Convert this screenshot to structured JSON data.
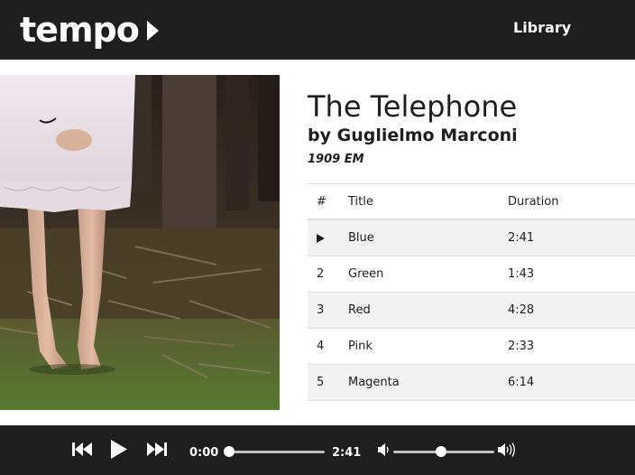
{
  "header": {
    "logo": "tempo",
    "nav_library": "Library"
  },
  "album": {
    "title": "The Telephone",
    "artist": "by Guglielmo Marconi",
    "year": "1909 EM"
  },
  "track_table": {
    "headers": {
      "number": "#",
      "title": "Title",
      "duration": "Duration"
    },
    "rows": [
      {
        "number": "1",
        "title": "Blue",
        "duration": "2:41",
        "playing": true
      },
      {
        "number": "2",
        "title": "Green",
        "duration": "1:43",
        "playing": false
      },
      {
        "number": "3",
        "title": "Red",
        "duration": "4:28",
        "playing": false
      },
      {
        "number": "4",
        "title": "Pink",
        "duration": "2:33",
        "playing": false
      },
      {
        "number": "5",
        "title": "Magenta",
        "duration": "6:14",
        "playing": false
      }
    ]
  },
  "player": {
    "current_time": "0:00",
    "total_time": "2:41",
    "progress_fraction": 0.0,
    "volume_fraction": 0.47,
    "icons": [
      "skip-back-icon",
      "play-icon",
      "skip-forward-icon",
      "volume-low-icon",
      "volume-high-icon"
    ]
  },
  "colors": {
    "bar_background": "#1e1e1e",
    "alt_row": "#f2f2f2",
    "text": "#1e1e1e",
    "white": "#ffffff"
  }
}
